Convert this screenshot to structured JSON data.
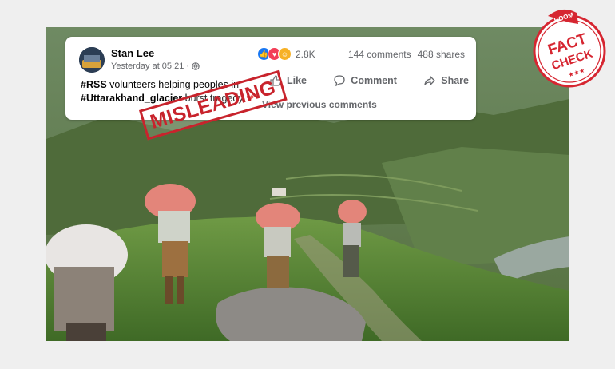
{
  "post": {
    "author": "Stan Lee",
    "time": "Yesterday at 05:21",
    "time_sep": "·",
    "text_line1_tag": "#RSS",
    "text_line1_rest": " volunteers helping peoples in",
    "text_line2_tag": "#Uttarakhand_glacier",
    "text_line2_rest": " burst tragedy",
    "reaction_count": "2.8K",
    "comments": "144 comments",
    "shares": "488 shares",
    "like_label": "Like",
    "comment_label": "Comment",
    "share_label": "Share",
    "previous_comments": "View previous comments"
  },
  "stamp": {
    "text": "MISLEADING"
  },
  "badge": {
    "top": "BOOM",
    "line1": "FACT",
    "line2": "CHECK"
  },
  "colors": {
    "stamp_red": "#c8232c",
    "fb_blue": "#1877f2",
    "page_bg": "#efefef"
  },
  "icons": [
    "globe-icon",
    "like-icon",
    "comment-icon",
    "share-icon",
    "heart-icon"
  ]
}
